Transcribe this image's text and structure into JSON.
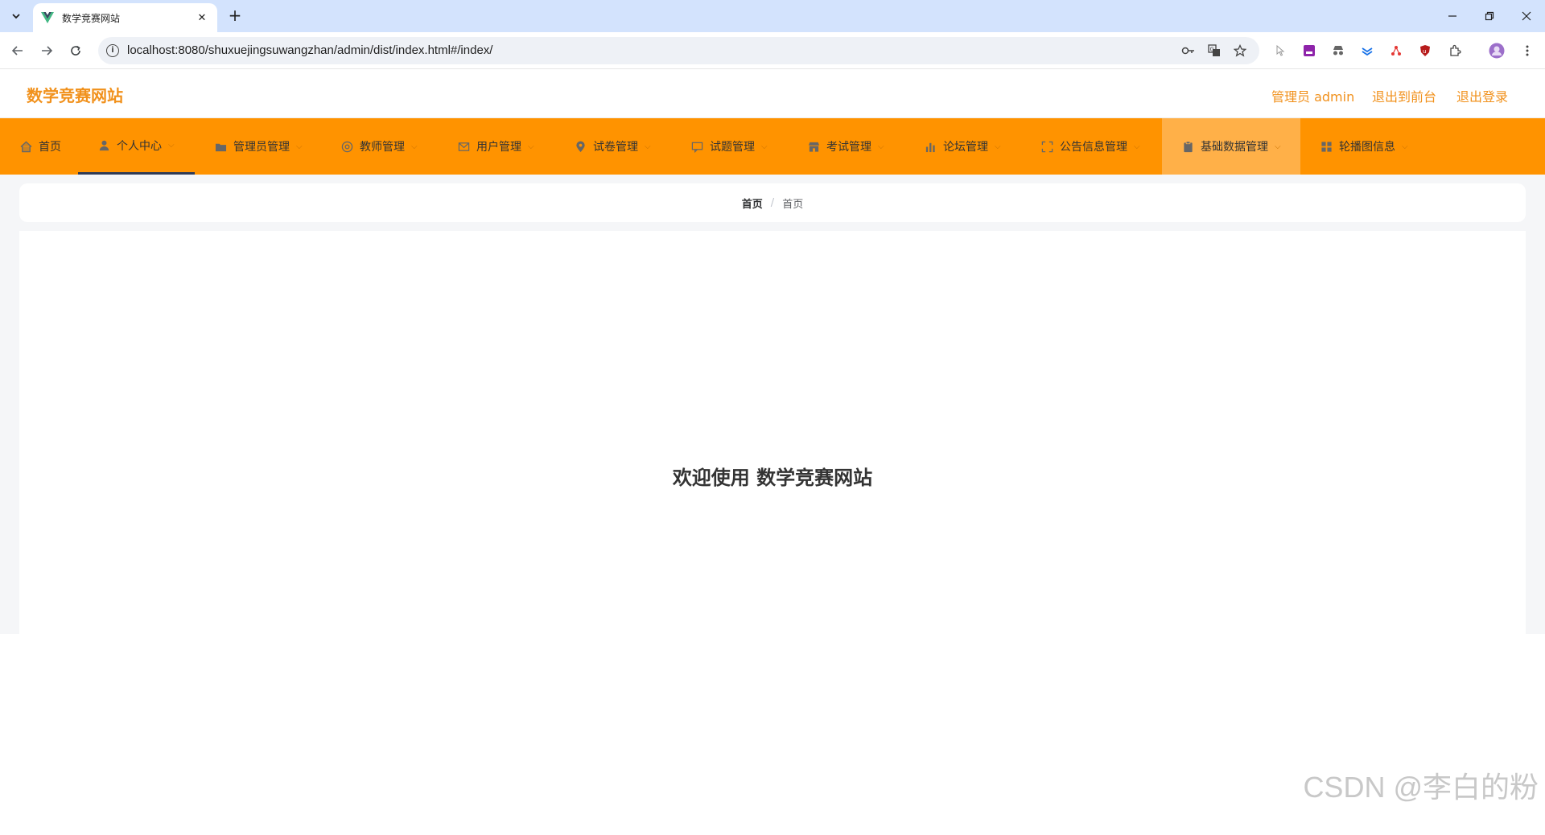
{
  "browser": {
    "tab_title": "数学竞赛网站",
    "url": "localhost:8080/shuxuejingsuwangzhan/admin/dist/index.html#/index/"
  },
  "header": {
    "title": "数学竞赛网站",
    "user_label": "管理员 admin",
    "to_front": "退出到前台",
    "logout": "退出登录"
  },
  "nav": [
    {
      "label": "首页",
      "icon": "home-icon"
    },
    {
      "label": "个人中心",
      "icon": "user-icon"
    },
    {
      "label": "管理员管理",
      "icon": "folder-icon"
    },
    {
      "label": "教师管理",
      "icon": "circle-icon"
    },
    {
      "label": "用户管理",
      "icon": "mail-icon"
    },
    {
      "label": "试卷管理",
      "icon": "location-icon"
    },
    {
      "label": "试题管理",
      "icon": "message-icon"
    },
    {
      "label": "考试管理",
      "icon": "shop-icon"
    },
    {
      "label": "论坛管理",
      "icon": "chart-icon"
    },
    {
      "label": "公告信息管理",
      "icon": "fullscreen-icon"
    },
    {
      "label": "基础数据管理",
      "icon": "clipboard-icon"
    },
    {
      "label": "轮播图信息",
      "icon": "grid-icon"
    }
  ],
  "breadcrumb": [
    "首页",
    "首页"
  ],
  "welcome": "欢迎使用 数学竞赛网站",
  "watermark": "CSDN @李白的粉",
  "colors": {
    "accent": "#ff9300",
    "title": "#f1911c"
  }
}
